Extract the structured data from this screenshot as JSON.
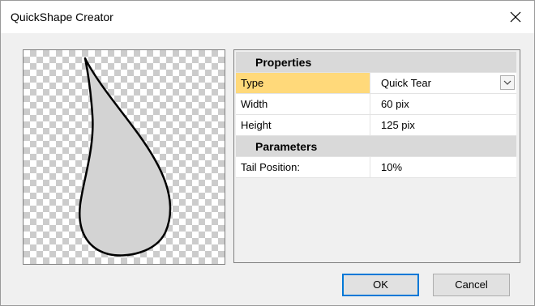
{
  "window": {
    "title": "QuickShape Creator",
    "close_icon": "close-icon"
  },
  "preview": {
    "shape": "tear-drop",
    "fill_color": "#d3d3d3",
    "stroke_color": "#000000"
  },
  "properties": {
    "section_label": "Properties",
    "rows": [
      {
        "name": "Type",
        "value": "Quick Tear",
        "selected": true
      },
      {
        "name": "Width",
        "value": "60 pix"
      },
      {
        "name": "Height",
        "value": "125 pix"
      }
    ]
  },
  "parameters": {
    "section_label": "Parameters",
    "rows": [
      {
        "name": "Tail Position:",
        "value": "10%"
      }
    ]
  },
  "buttons": {
    "ok_label": "OK",
    "cancel_label": "Cancel"
  },
  "colors": {
    "selected_row": "#ffd97a",
    "section_bg": "#d9d9d9",
    "accent": "#0078d7"
  }
}
